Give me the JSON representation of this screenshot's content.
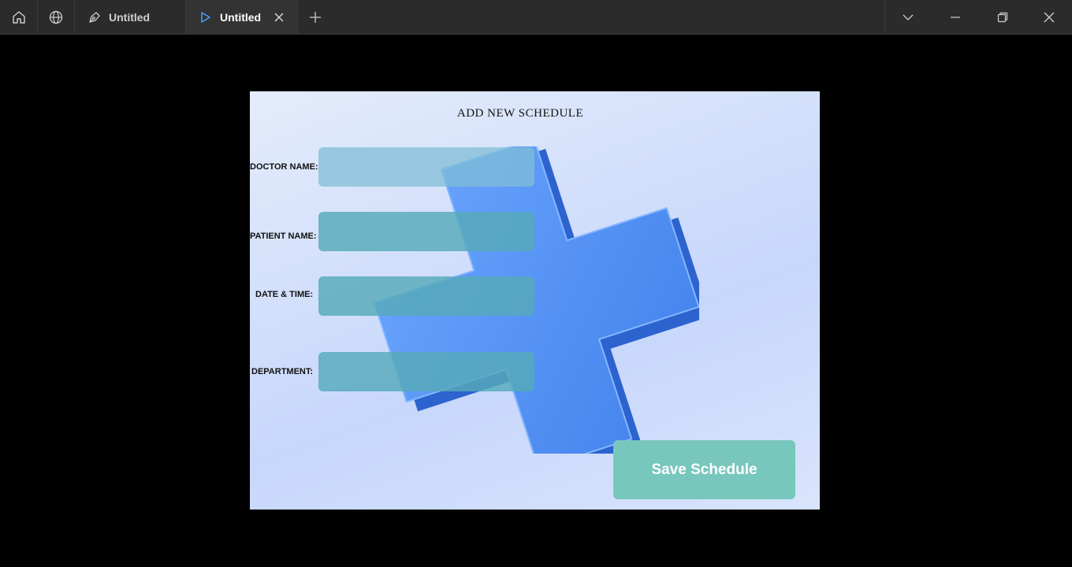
{
  "titlebar": {
    "icons": [
      "home-icon",
      "globe-icon",
      "pen-tool-icon",
      "play-icon",
      "close-icon",
      "plus-icon",
      "chevron-down-icon",
      "minimize-icon",
      "restore-icon",
      "window-close-icon"
    ],
    "tabs": [
      {
        "label": "Untitled",
        "active": false
      },
      {
        "label": "Untitled",
        "active": true
      }
    ]
  },
  "form": {
    "title": "ADD  NEW SCHEDULE",
    "fields": [
      {
        "label": "DOCTOR NAME:",
        "value": ""
      },
      {
        "label": "PATIENT NAME:",
        "value": ""
      },
      {
        "label": "DATE & TIME:",
        "value": ""
      },
      {
        "label": "DEPARTMENT:",
        "value": ""
      }
    ],
    "save_label": "Save Schedule"
  },
  "colors": {
    "titlebar_bg": "#2b2b2b",
    "active_tab_bg": "#333333",
    "play_icon": "#4aa3ff",
    "field_bg": "#56aaba",
    "save_button_bg": "#78c7bd",
    "cross_blue": "#3f7fea"
  }
}
